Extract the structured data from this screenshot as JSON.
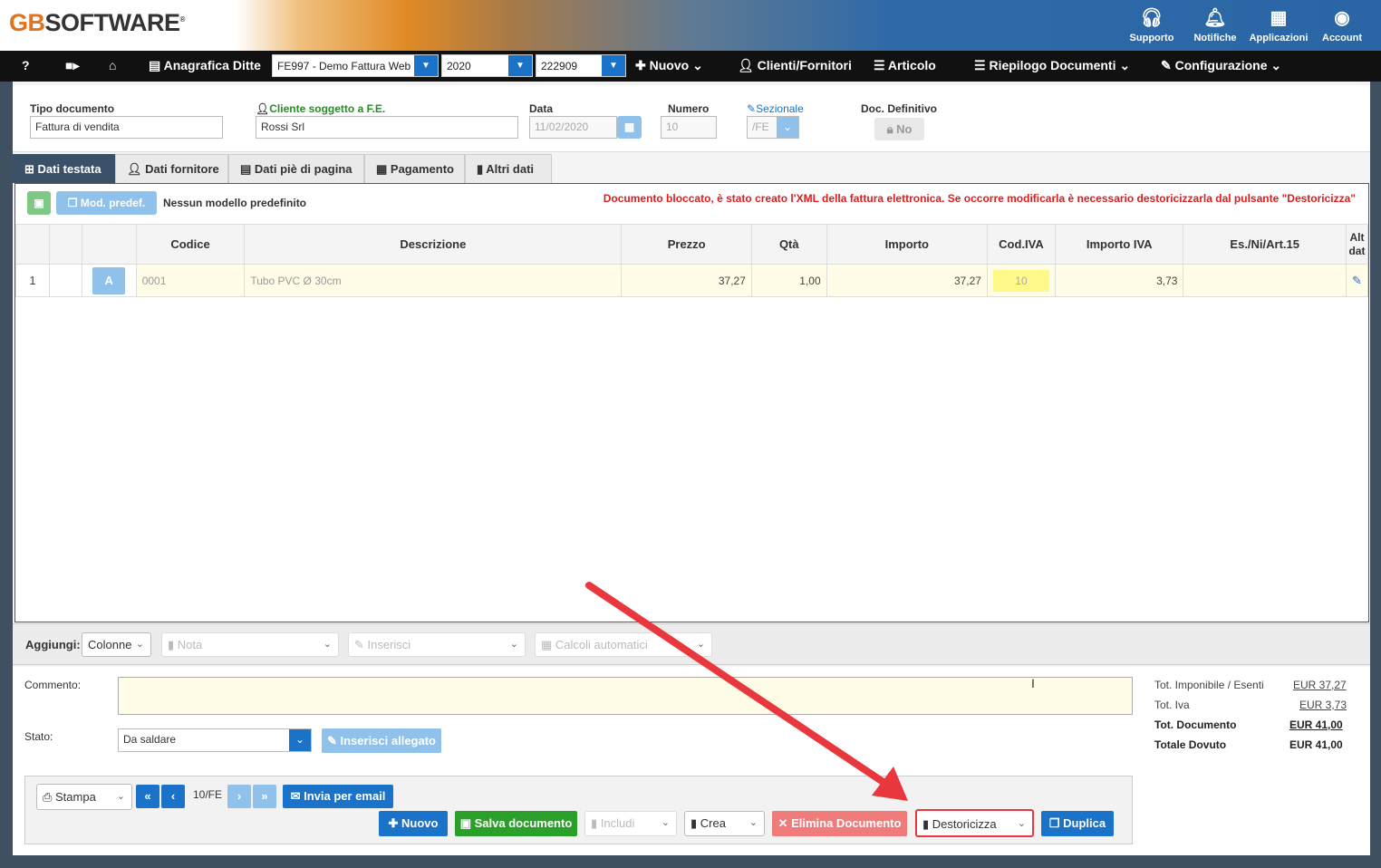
{
  "brand": {
    "logo_text": "SOFTWARE",
    "logo_prefix": "GB",
    "reg": "®"
  },
  "header_icons": [
    {
      "icon": "headset-icon",
      "label": "Supporto"
    },
    {
      "icon": "bell-icon",
      "label": "Notifiche"
    },
    {
      "icon": "grid-icon",
      "label": "Applicazioni"
    },
    {
      "icon": "user-circle-icon",
      "label": "Account"
    }
  ],
  "nav": {
    "help": "?",
    "anagrafica": "Anagrafica Ditte",
    "ditta_value": "FE997 - Demo Fattura Web",
    "year_value": "2020",
    "code_value": "222909",
    "nuovo": "Nuovo",
    "clienti": "Clienti/Fornitori",
    "articolo": "Articolo",
    "riepilogo": "Riepilogo Documenti",
    "configurazione": "Configurazione"
  },
  "form": {
    "tipo_label": "Tipo documento",
    "tipo_value": "Fattura di vendita",
    "cliente_label": "Cliente soggetto a F.E.",
    "cliente_value": "Rossi Srl",
    "data_label": "Data",
    "data_value": "11/02/2020",
    "numero_label": "Numero",
    "numero_value": "10",
    "sezionale_label": "Sezionale",
    "sezionale_value": "/FE",
    "definitivo_label": "Doc. Definitivo",
    "definitivo_value": "No"
  },
  "tabs": [
    "Dati testata",
    "Dati fornitore",
    "Dati piè di pagina",
    "Pagamento",
    "Altri dati"
  ],
  "toolbar": {
    "mod_predef": "Mod. predef.",
    "nessun_modello": "Nessun modello predefinito"
  },
  "warning": "Documento bloccato, è stato creato l'XML della fattura elettronica. Se occorre modificarla è necessario destoricizzarla dal pulsante \"Destoricizza\"",
  "table": {
    "headers": [
      "",
      "",
      "",
      "Codice",
      "Descrizione",
      "Prezzo",
      "Qtà",
      "Importo",
      "Cod.IVA",
      "Importo IVA",
      "Es./Ni/Art.15",
      "Alt dat"
    ],
    "rows": [
      {
        "n": "1",
        "tipo": "A",
        "codice": "0001",
        "descrizione": "Tubo PVC Ø 30cm",
        "prezzo": "37,27",
        "qta": "1,00",
        "importo": "37,27",
        "codiva": "10",
        "importo_iva": "3,73",
        "esente": ""
      }
    ]
  },
  "bar": {
    "aggiungi": "Aggiungi:",
    "colonne": "Colonne",
    "nota": "Nota",
    "inserisci": "Inserisci",
    "calcoli": "Calcoli automatici"
  },
  "footer": {
    "commento_label": "Commento:",
    "stato_label": "Stato:",
    "stato_value": "Da saldare",
    "allegato": "Inserisci allegato",
    "stampa": "Stampa",
    "page_ref": "10/FE",
    "email": "Invia per email",
    "nuovo": "Nuovo",
    "salva": "Salva documento",
    "includi": "Includi",
    "crea": "Crea",
    "elimina": "Elimina Documento",
    "destoricizza": "Destoricizza",
    "duplica": "Duplica"
  },
  "totals": [
    {
      "label": "Tot. Imponibile / Esenti",
      "value": "EUR 37,27"
    },
    {
      "label": "Tot. Iva",
      "value": "EUR 3,73"
    },
    {
      "label": "Tot. Documento",
      "value": "EUR 41,00"
    },
    {
      "label": "Totale Dovuto",
      "value": "EUR 41,00"
    }
  ],
  "colors": {
    "accent": "#1a73c9",
    "warning": "#e01d1d",
    "annotation": "#e8383d"
  }
}
